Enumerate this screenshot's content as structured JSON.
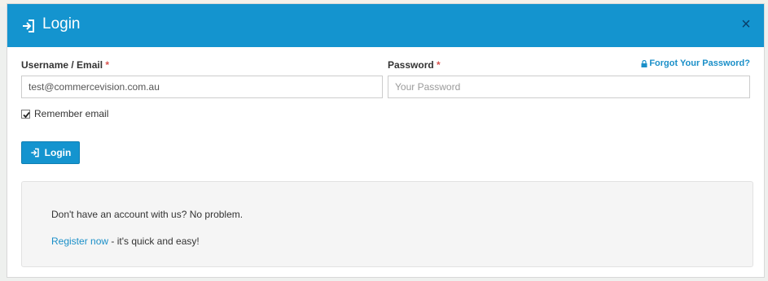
{
  "modal": {
    "title": "Login",
    "close_label": "×"
  },
  "form": {
    "username_label": "Username / Email",
    "username_value": "test@commercevision.com.au",
    "password_label": "Password",
    "password_placeholder": "Your Password",
    "required_marker": "*",
    "forgot_label": "Forgot Your Password?",
    "remember_label": "Remember email",
    "remember_checked": true,
    "login_button": "Login"
  },
  "register": {
    "question": "Don't have an account with us? No problem.",
    "link_label": "Register now",
    "tail": " - it's quick and easy!"
  },
  "colors": {
    "header": "#1494cf",
    "link": "#1a8fc8",
    "required": "#d9534f"
  },
  "icons": {
    "header": "sign-in-icon",
    "close": "close-icon",
    "forgot": "lock-icon",
    "button": "sign-in-icon"
  }
}
